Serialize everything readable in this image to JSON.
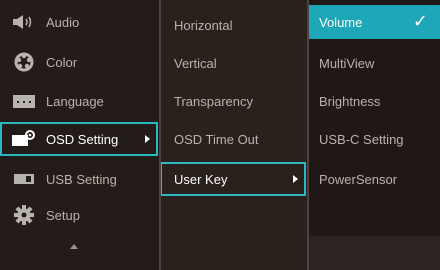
{
  "menu": {
    "items": [
      {
        "label": "Audio",
        "icon": "speaker-icon"
      },
      {
        "label": "Color",
        "icon": "color-palette-icon"
      },
      {
        "label": "Language",
        "icon": "language-keyboard-icon"
      },
      {
        "label": "OSD Setting",
        "icon": "osd-settings-icon"
      },
      {
        "label": "USB Setting",
        "icon": "usb-icon"
      },
      {
        "label": "Setup",
        "icon": "gear-icon"
      }
    ]
  },
  "submenu": {
    "items": [
      {
        "label": "Horizontal"
      },
      {
        "label": "Vertical"
      },
      {
        "label": "Transparency"
      },
      {
        "label": "OSD Time Out"
      },
      {
        "label": "User Key"
      }
    ]
  },
  "options": {
    "items": [
      {
        "label": "Volume"
      },
      {
        "label": "MultiView"
      },
      {
        "label": "Brightness"
      },
      {
        "label": "USB-C Setting"
      },
      {
        "label": "PowerSensor"
      }
    ]
  },
  "colors": {
    "accent": "#2bb7c6",
    "active_bg": "#1ea7b8",
    "panel_bg": "#241c18",
    "text": "#b9b3ad"
  }
}
